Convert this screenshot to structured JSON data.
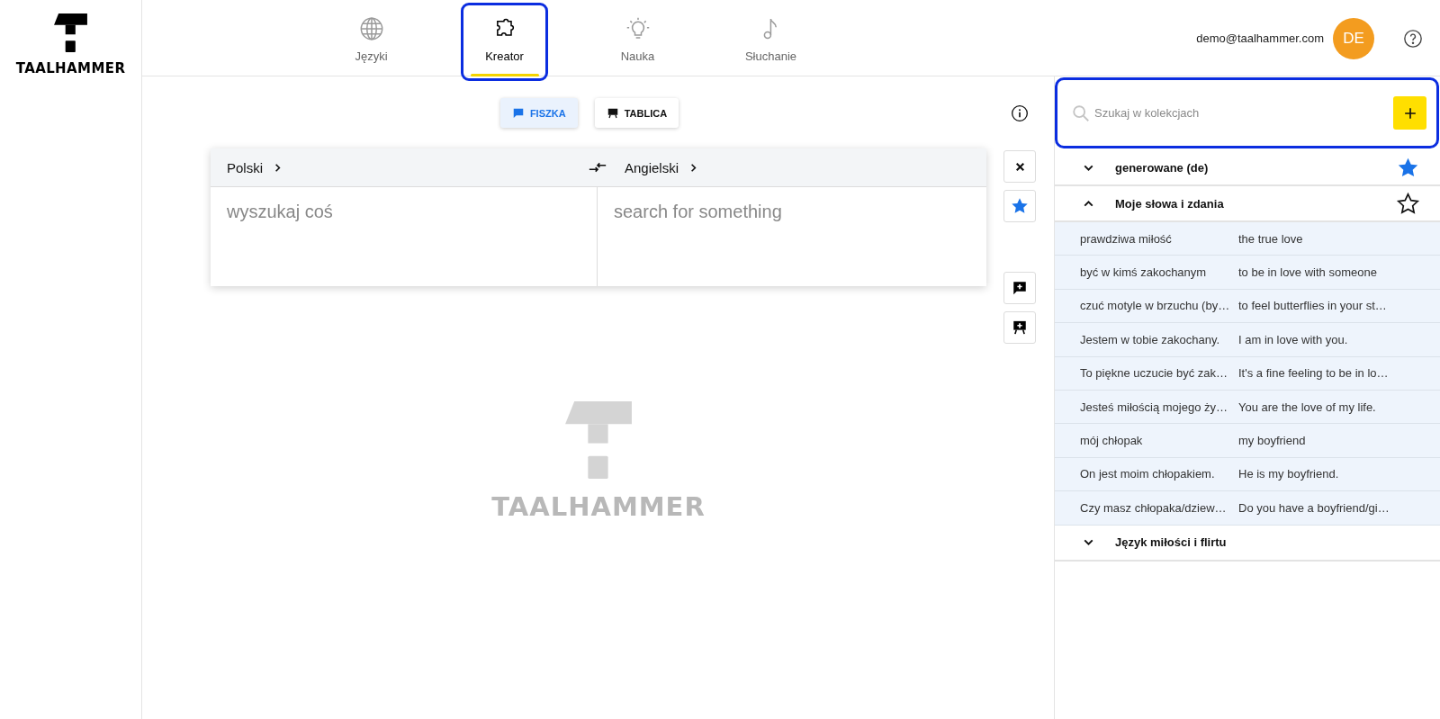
{
  "sidebar": {
    "logo_text": "TAALHAMMER"
  },
  "nav": {
    "tabs": [
      {
        "label": "Języki",
        "selected": false,
        "highlighted": false
      },
      {
        "label": "Kreator",
        "selected": true,
        "highlighted": true
      },
      {
        "label": "Nauka",
        "selected": false,
        "highlighted": false
      },
      {
        "label": "Słuchanie",
        "selected": false,
        "highlighted": false
      }
    ]
  },
  "account": {
    "email": "demo@taalhammer.com",
    "initials": "DE"
  },
  "mode_switch": {
    "modes": [
      {
        "label": "FISZKA",
        "selected": true
      },
      {
        "label": "TABLICA",
        "selected": false
      }
    ]
  },
  "translator": {
    "source_language": "Polski",
    "target_language": "Angielski",
    "source_placeholder": "wyszukaj coś",
    "target_placeholder": "search for something",
    "favorite": true
  },
  "empty_state": {
    "logo_text": "TAALHAMMER"
  },
  "collections": {
    "search": {
      "placeholder": "Szukaj w kolekcjach",
      "highlighted": true
    },
    "groups": [
      {
        "name": "generowane (de)",
        "expanded": false,
        "starred": true
      },
      {
        "name": "Moje słowa i zdania",
        "expanded": true,
        "starred": false,
        "entries": [
          {
            "source": "prawdziwa miłość",
            "target": "the true love"
          },
          {
            "source": "być w kimś zakochanym",
            "target": "to be in love with someone"
          },
          {
            "source": "czuć motyle w brzuchu (by…",
            "target": "to feel butterflies in your st…"
          },
          {
            "source": "Jestem w tobie zakochany.",
            "target": "I am in love with you."
          },
          {
            "source": "To piękne uczucie być zak…",
            "target": "It's a fine feeling to be in lo…"
          },
          {
            "source": "Jesteś miłością mojego ży…",
            "target": "You are the love of my life."
          },
          {
            "source": "mój chłopak",
            "target": "my boyfriend"
          },
          {
            "source": "On jest moim chłopakiem.",
            "target": "He is my boyfriend."
          },
          {
            "source": "Czy masz chłopaka/dziew…",
            "target": "Do you have a boyfriend/gi…"
          }
        ]
      },
      {
        "name": "Język miłości i flirtu",
        "expanded": false
      }
    ]
  }
}
